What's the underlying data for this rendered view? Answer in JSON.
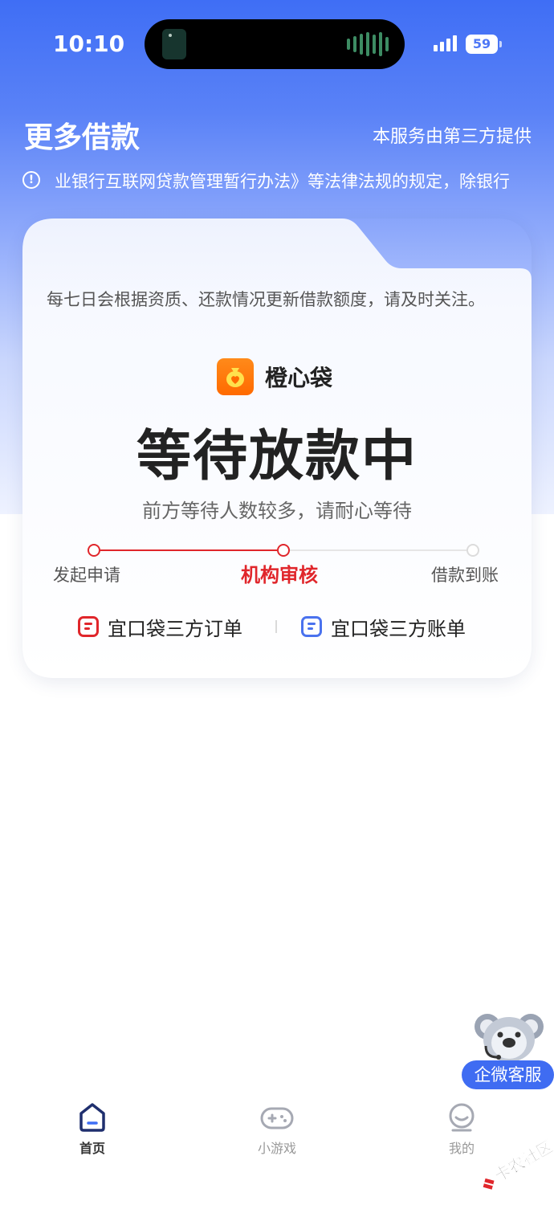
{
  "status_bar": {
    "time": "10:10",
    "battery": "59"
  },
  "header": {
    "title": "更多借款",
    "provider_note": "本服务由第三方提供"
  },
  "notice": {
    "text": "业银行互联网贷款管理暂行办法》等法律法规的规定，除银行"
  },
  "card": {
    "description": "每七日会根据资质、还款情况更新借款额度，请及时关注。",
    "brand_name": "橙心袋",
    "status_title": "等待放款中",
    "status_subtitle": "前方等待人数较多，请耐心等待",
    "steps": [
      {
        "label": "发起申请",
        "state": "done"
      },
      {
        "label": "机构审核",
        "state": "current"
      },
      {
        "label": "借款到账",
        "state": "pending"
      }
    ],
    "links": {
      "orders": "宜口袋三方订单",
      "bills": "宜口袋三方账单"
    }
  },
  "floating": {
    "customer_service": "企微客服"
  },
  "tabbar": {
    "items": [
      {
        "label": "首页",
        "icon": "home-icon",
        "active": true
      },
      {
        "label": "小游戏",
        "icon": "gamepad-icon",
        "active": false
      },
      {
        "label": "我的",
        "icon": "profile-icon",
        "active": false
      }
    ]
  },
  "watermark": {
    "text": "卡农社区"
  },
  "colors": {
    "brand_blue": "#3f6ef5",
    "accent_red": "#e0262b",
    "brand_orange": "#ff7a0d",
    "link_blue": "#4a72ee"
  }
}
